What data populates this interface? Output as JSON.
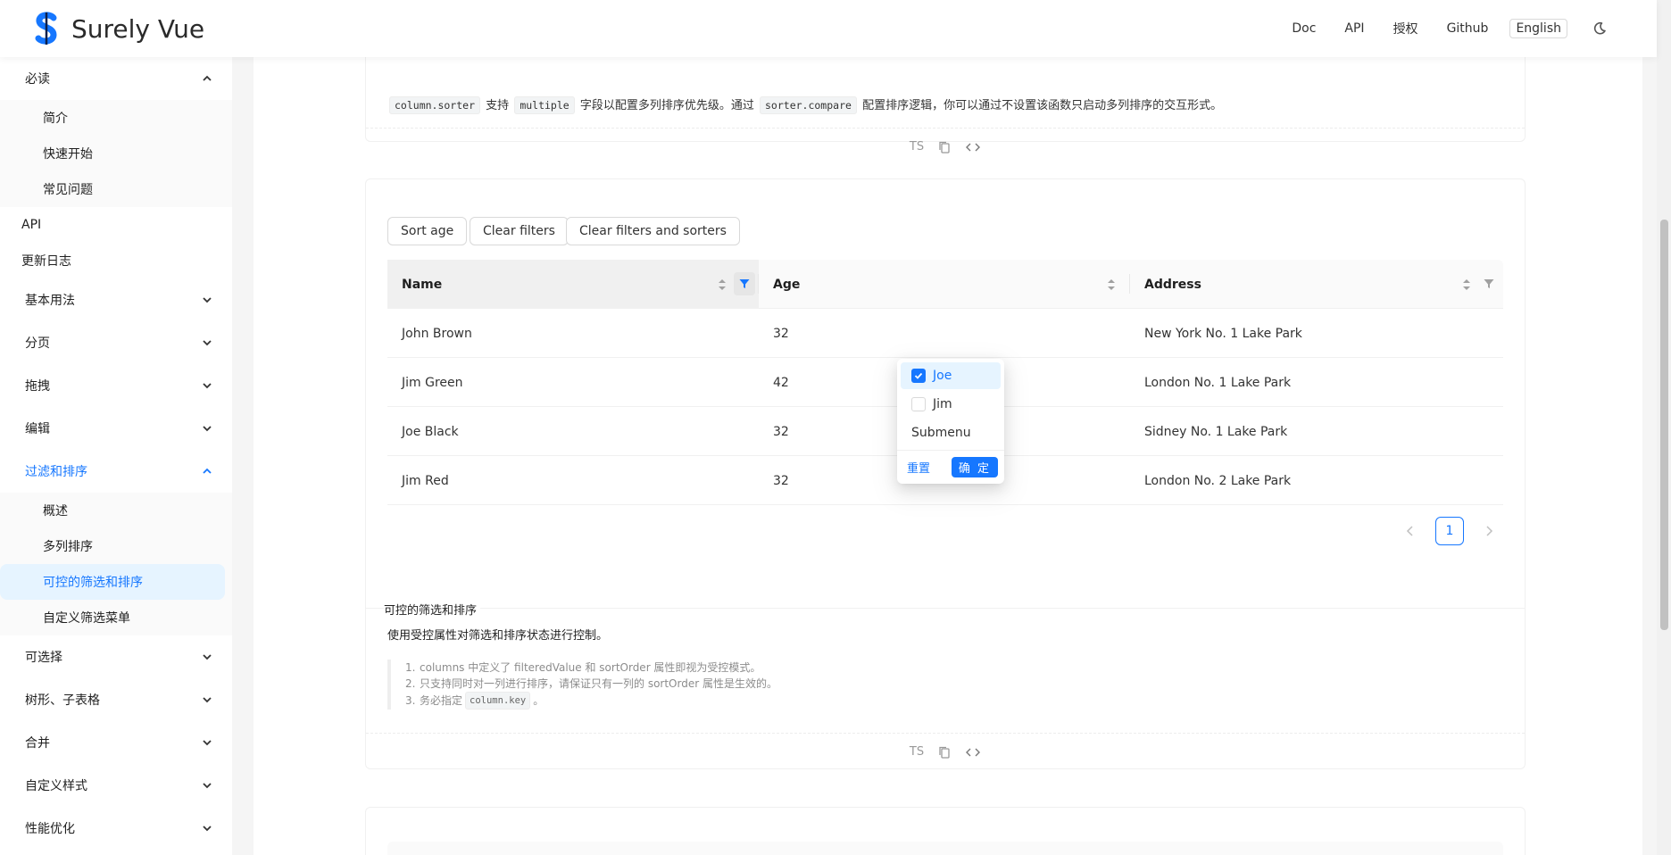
{
  "header": {
    "title": "Surely Vue",
    "nav": [
      "Doc",
      "API",
      "授权",
      "Github"
    ],
    "lang_button": "English"
  },
  "sidebar": {
    "group_must_read": "必读",
    "must_read_items": [
      "简介",
      "快速开始",
      "常见问题"
    ],
    "api": "API",
    "changelog": "更新日志",
    "groups_before": [
      "基本用法",
      "分页",
      "拖拽",
      "编辑"
    ],
    "active_group": "过滤和排序",
    "active_items": [
      "概述",
      "多列排序",
      "可控的筛选和排序",
      "自定义筛选菜单"
    ],
    "groups_after": [
      "可选择",
      "树形、子表格",
      "合并",
      "自定义样式",
      "性能优化"
    ]
  },
  "card1": {
    "desc": {
      "code1": "column.sorter",
      "t1": "支持",
      "code2": "multiple",
      "t2": "字段以配置多列排序优先级。通过",
      "code3": "sorter.compare",
      "t3": "配置排序逻辑，你可以通过不设置该函数只启动多列排序的交互形式。"
    },
    "code_bar": {
      "ts": "TS"
    }
  },
  "card2": {
    "buttons": [
      "Sort age",
      "Clear filters",
      "Clear filters and sorters"
    ],
    "columns": [
      "Name",
      "Age",
      "Address"
    ],
    "rows": [
      {
        "name": "John Brown",
        "age": "32",
        "address": "New York No. 1 Lake Park"
      },
      {
        "name": "Jim Green",
        "age": "42",
        "address": "London No. 1 Lake Park"
      },
      {
        "name": "Joe Black",
        "age": "32",
        "address": "Sidney No. 1 Lake Park"
      },
      {
        "name": "Jim Red",
        "age": "32",
        "address": "London No. 2 Lake Park"
      }
    ],
    "pagination": {
      "current": "1"
    },
    "section_title": "可控的筛选和排序",
    "section_desc": "使用受控属性对筛选和排序状态进行控制。",
    "notes": [
      {
        "n": "1.",
        "text": "columns 中定义了 filteredValue 和 sortOrder 属性即视为受控模式。"
      },
      {
        "n": "2.",
        "text": "只支持同时对一列进行排序，请保证只有一列的 sortOrder 属性是生效的。"
      },
      {
        "n": "3.",
        "pre": "务必指定",
        "code": "column.key",
        "post": "。"
      }
    ],
    "code_bar": {
      "ts": "TS"
    }
  },
  "filter_dropdown": {
    "items": [
      {
        "label": "Joe",
        "checked": true
      },
      {
        "label": "Jim",
        "checked": false
      }
    ],
    "submenu": "Submenu",
    "reset": "重置",
    "ok": "确 定"
  },
  "colors": {
    "primary": "#1677ff",
    "selected_bg": "#e6f4ff"
  }
}
